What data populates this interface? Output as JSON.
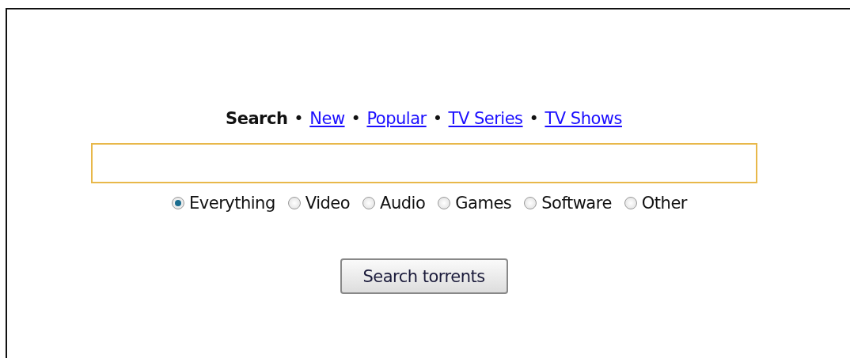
{
  "nav": [
    {
      "label": "Search",
      "selected": true
    },
    {
      "label": "New",
      "selected": false,
      "separator": "•"
    },
    {
      "label": "Popular",
      "selected": false,
      "separator": "•"
    },
    {
      "label": "TV Series",
      "selected": false,
      "separator": "•"
    },
    {
      "label": "TV Shows",
      "selected": false,
      "separator": "•"
    }
  ],
  "search": {
    "focused": true
  },
  "categories": [
    {
      "label": "Everything",
      "selected": true
    },
    {
      "label": "Video",
      "selected": false
    },
    {
      "label": "Audio",
      "selected": false
    },
    {
      "label": "Games",
      "selected": false
    },
    {
      "label": "Software",
      "selected": false
    },
    {
      "label": "Other",
      "selected": false
    }
  ],
  "button": "Search torrents"
}
